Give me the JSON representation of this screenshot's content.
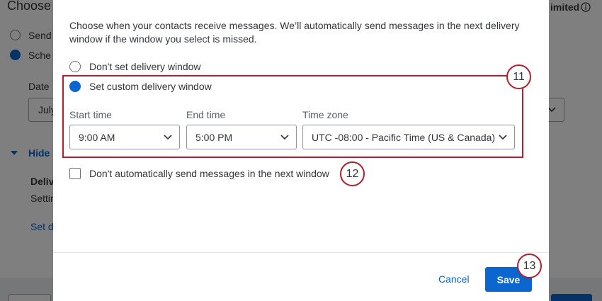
{
  "background": {
    "title_partial": "Choose",
    "option_send_partial": "Send",
    "option_schedule_partial": "Sche",
    "date_label_partial": "Date",
    "date_value_partial": "July",
    "hide_partial": "Hide",
    "delivery_partial": "Deliv",
    "setting_partial": "Settin",
    "set_link_partial": "Set d",
    "top_right_partial": "imited"
  },
  "modal": {
    "description": "Choose when your contacts receive messages. We’ll automatically send messages in the next delivery window if the window you select is missed.",
    "options": {
      "no_window": "Don't set delivery window",
      "custom_window": "Set custom delivery window"
    },
    "selected_option": "custom_window",
    "start_time": {
      "label": "Start time",
      "value": "9:00 AM"
    },
    "end_time": {
      "label": "End time",
      "value": "5:00 PM"
    },
    "time_zone": {
      "label": "Time zone",
      "value": "UTC -08:00 - Pacific Time (US & Canada)"
    },
    "no_auto_send": {
      "label": "Don't automatically send messages in the next window",
      "checked": false
    },
    "cancel_label": "Cancel",
    "save_label": "Save"
  },
  "callouts": [
    "11",
    "12",
    "13"
  ],
  "colors": {
    "accent": "#0b66d0",
    "callout_red": "#b01e2f"
  }
}
